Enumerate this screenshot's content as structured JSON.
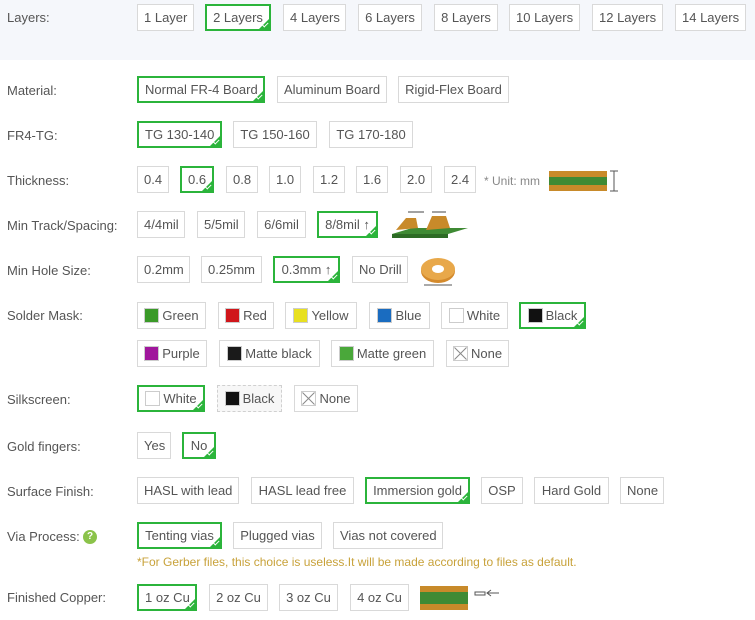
{
  "layers": {
    "label": "Layers:",
    "options": [
      "1 Layer",
      "2 Layers",
      "4 Layers",
      "6 Layers",
      "8 Layers",
      "10 Layers",
      "12 Layers",
      "14 Layers"
    ],
    "selected": "2 Layers"
  },
  "material": {
    "label": "Material:",
    "options": [
      "Normal FR-4 Board",
      "Aluminum Board",
      "Rigid-Flex Board"
    ],
    "selected": "Normal FR-4 Board"
  },
  "fr4_tg": {
    "label": "FR4-TG:",
    "options": [
      "TG 130-140",
      "TG 150-160",
      "TG 170-180"
    ],
    "selected": "TG 130-140"
  },
  "thickness": {
    "label": "Thickness:",
    "options": [
      "0.4",
      "0.6",
      "0.8",
      "1.0",
      "1.2",
      "1.6",
      "2.0",
      "2.4"
    ],
    "selected": "0.6",
    "unit_note": "* Unit: mm"
  },
  "min_track": {
    "label": "Min Track/Spacing:",
    "options": [
      "4/4mil",
      "5/5mil",
      "6/6mil",
      "8/8mil ↑"
    ],
    "selected": "8/8mil ↑"
  },
  "min_hole": {
    "label": "Min Hole Size:",
    "options": [
      "0.2mm",
      "0.25mm",
      "0.3mm ↑",
      "No Drill"
    ],
    "selected": "0.3mm ↑"
  },
  "solder_mask": {
    "label": "Solder Mask:",
    "options": [
      {
        "name": "Green",
        "color": "#3a9a28"
      },
      {
        "name": "Red",
        "color": "#d0161b"
      },
      {
        "name": "Yellow",
        "color": "#e8e020"
      },
      {
        "name": "Blue",
        "color": "#1a6cc0"
      },
      {
        "name": "White",
        "color": "#ffffff"
      },
      {
        "name": "Black",
        "color": "#111111"
      },
      {
        "name": "Purple",
        "color": "#a0169c"
      },
      {
        "name": "Matte black",
        "color": "#1a1a1a"
      },
      {
        "name": "Matte green",
        "color": "#4aa83a"
      },
      {
        "name": "None",
        "color": "none"
      }
    ],
    "selected": "Black"
  },
  "silkscreen": {
    "label": "Silkscreen:",
    "options": [
      {
        "name": "White",
        "color": "#ffffff"
      },
      {
        "name": "Black",
        "color": "#111111"
      },
      {
        "name": "None",
        "color": "none"
      }
    ],
    "selected": "White"
  },
  "gold_fingers": {
    "label": "Gold fingers:",
    "options": [
      "Yes",
      "No"
    ],
    "selected": "No"
  },
  "surface_finish": {
    "label": "Surface Finish:",
    "options": [
      "HASL with lead",
      "HASL lead free",
      "Immersion gold",
      "OSP",
      "Hard Gold",
      "None"
    ],
    "selected": "Immersion gold"
  },
  "via_process": {
    "label": "Via Process:",
    "help_icon": "?",
    "options": [
      "Tenting vias",
      "Plugged vias",
      "Vias not covered"
    ],
    "selected": "Tenting vias",
    "note": "*For Gerber files, this choice is useless.It will be made according to files as default."
  },
  "finished_copper": {
    "label": "Finished Copper:",
    "options": [
      "1 oz Cu",
      "2 oz Cu",
      "3 oz Cu",
      "4 oz Cu"
    ],
    "selected": "1 oz Cu"
  },
  "accent_color": "#2bb43b"
}
